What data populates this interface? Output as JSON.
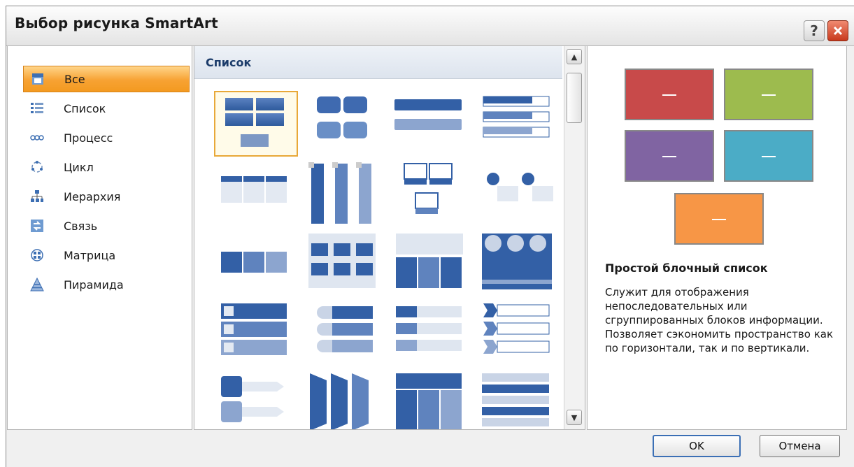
{
  "dialog": {
    "title": "Выбор рисунка SmartArt",
    "help_symbol": "?",
    "close_symbol": "✕"
  },
  "categories": [
    {
      "label": "Все",
      "icon": "all-icon",
      "selected": true
    },
    {
      "label": "Список",
      "icon": "list-icon"
    },
    {
      "label": "Процесс",
      "icon": "process-icon"
    },
    {
      "label": "Цикл",
      "icon": "cycle-icon"
    },
    {
      "label": "Иерархия",
      "icon": "hierarchy-icon"
    },
    {
      "label": "Связь",
      "icon": "relationship-icon"
    },
    {
      "label": "Матрица",
      "icon": "matrix-icon"
    },
    {
      "label": "Пирамида",
      "icon": "pyramid-icon"
    }
  ],
  "gallery": {
    "header": "Список",
    "scroll_up": "▲",
    "scroll_down": "▼",
    "selected_index": 0
  },
  "preview": {
    "title": "Простой блочный список",
    "description": "Служит для отображения непоследовательных или сгруппированных блоков информации. Позволяет сэкономить пространство как по горизонтали, так и по вертикали.",
    "colors": [
      "#c84a4a",
      "#9dbb4e",
      "#8064a2",
      "#4bacc6",
      "#f79646"
    ]
  },
  "buttons": {
    "ok": "OK",
    "cancel": "Отмена"
  }
}
